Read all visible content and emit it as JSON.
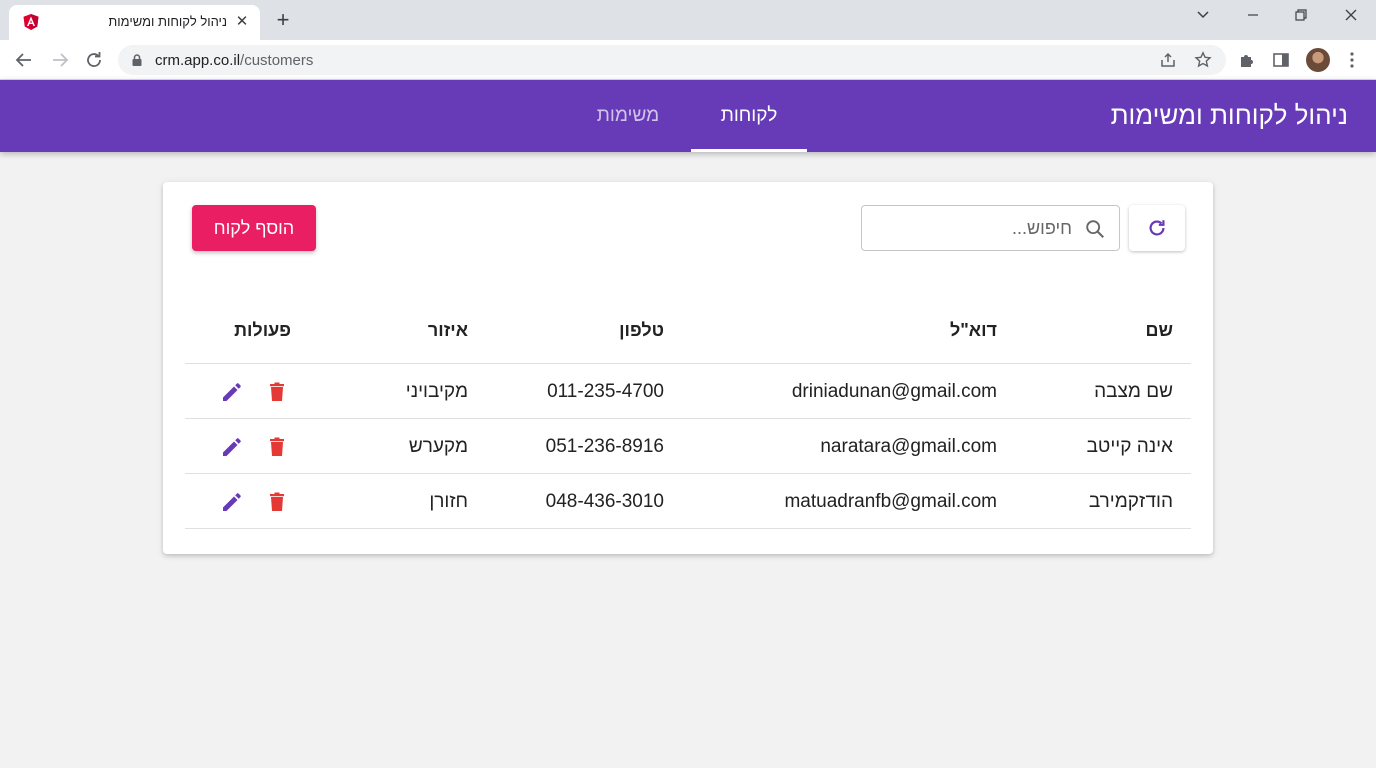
{
  "browser": {
    "tab_title": "ניהול לקוחות ומשימות",
    "url_host": "crm.app.co.il",
    "url_path": "/customers"
  },
  "app": {
    "title": "ניהול לקוחות ומשימות",
    "nav": [
      {
        "label": "לקוחות",
        "active": true
      },
      {
        "label": "משימות",
        "active": false
      }
    ],
    "accent": "#673ab7"
  },
  "toolbar": {
    "search_placeholder": "חיפוש...",
    "add_label": "הוסף לקוח"
  },
  "table": {
    "headers": {
      "name": "שם",
      "email": "דוא\"ל",
      "phone": "טלפון",
      "region": "איזור",
      "actions": "פעולות"
    },
    "rows": [
      {
        "name": "שם מצבה",
        "email": "driniadunan@gmail.com",
        "phone": "011-235-4700",
        "region": "מקיבויני"
      },
      {
        "name": "אינה קייטב",
        "email": "naratara@gmail.com",
        "phone": "051-236-8916",
        "region": "מקערש"
      },
      {
        "name": "הודזקמירב",
        "email": "matuadranfb@gmail.com",
        "phone": "048-436-3010",
        "region": "חזורן"
      }
    ]
  }
}
